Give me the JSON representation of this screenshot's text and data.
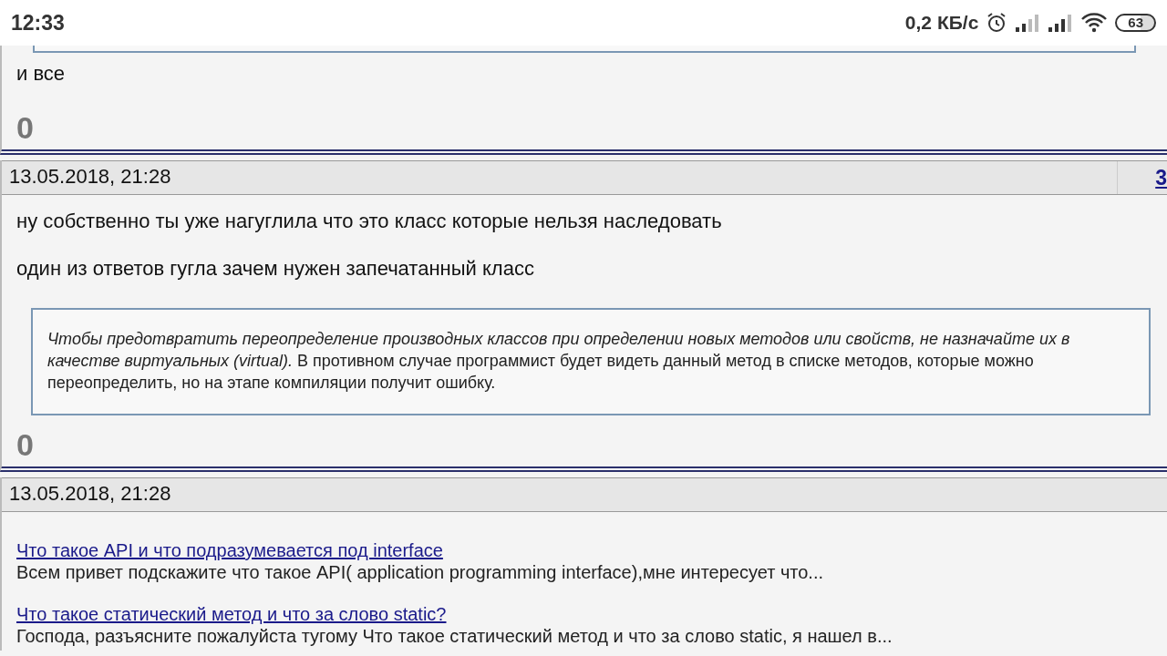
{
  "status_bar": {
    "time": "12:33",
    "speed": "0,2 КБ/с",
    "battery": "63"
  },
  "posts": [
    {
      "continues_quote": true,
      "blocks": [
        {
          "kind": "text",
          "text": "и все"
        }
      ],
      "rating": "0"
    },
    {
      "date": "13.05.2018, 21:28",
      "number": "3",
      "blocks": [
        {
          "kind": "text",
          "text": "ну собственно ты уже нагуглила что это класс которые нельзя наследовать"
        },
        {
          "kind": "text",
          "text": "один из ответов гугла зачем нужен запечатанный класс"
        },
        {
          "kind": "quote",
          "text": "*Чтобы предотвратить переопределение производных классов при определении новых методов или свойств, не назначайте их в качестве виртуальных (virtual).* В противном случае программист будет видеть данный метод в списке методов, которые можно переопределить, но на этапе компиляции получит ошибку."
        }
      ],
      "rating": "0"
    },
    {
      "date": "13.05.2018, 21:28",
      "blocks": [
        {
          "kind": "link",
          "title": "Что такое API и что подразумевается под interface",
          "snippet": "Всем привет подскажите что такое API( application programming interface),мне интересует что..."
        },
        {
          "kind": "link",
          "title": "Что такое статический метод и что за слово static?",
          "snippet": "Господа, разъясните пожалуйста тугому Что такое статический метод и что за слово static, я нашел в..."
        }
      ]
    }
  ]
}
